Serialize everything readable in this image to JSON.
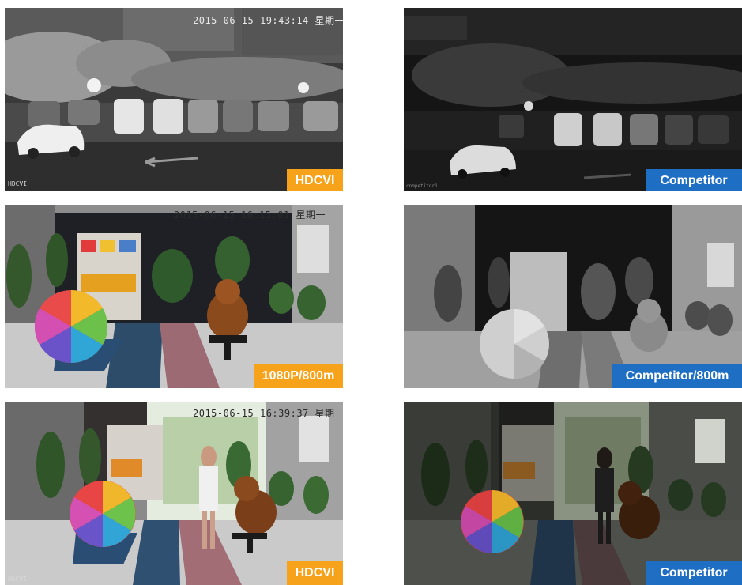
{
  "panels": [
    {
      "timestamp": "2015-06-15 19:43:14 星期一",
      "watermark": "HDCVI",
      "badge": "HDCVI",
      "badge_color": "#f7a21b"
    },
    {
      "watermark": "competitor1",
      "badge": "Competitor",
      "badge_color": "#1e6fc4"
    },
    {
      "timestamp": "2015-06-15 16:15:01 星期一",
      "badge": "1080P/800m",
      "badge_color": "#f7a21b"
    },
    {
      "badge": "Competitor/800m",
      "badge_color": "#1e6fc4"
    },
    {
      "timestamp": "2015-06-15 16:39:37 星期一",
      "watermark": "HDCVI",
      "badge": "HDCVI",
      "badge_color": "#f7a21b"
    },
    {
      "badge": "Competitor",
      "badge_color": "#1e6fc4"
    }
  ]
}
